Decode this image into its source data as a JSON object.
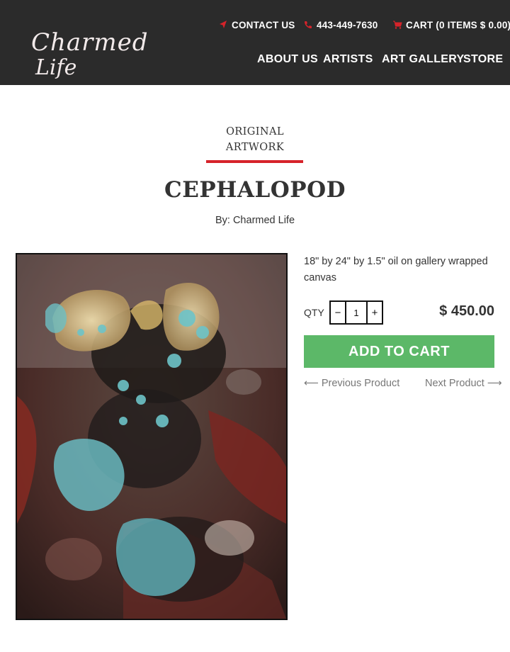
{
  "header": {
    "logo": {
      "line1": "Charmed",
      "line2": "Life"
    },
    "utility": {
      "contact_label": "CONTACT US",
      "phone": "443-449-7630",
      "cart_label": "CART (0 ITEMS $ 0.00)"
    },
    "nav": {
      "about": "ABOUT US",
      "artists": "ARTISTS",
      "gallery": "ART GALLERY",
      "store": "STORE"
    }
  },
  "product": {
    "collection_line1": "ORIGINAL",
    "collection_line2": "ARTWORK",
    "title": "CEPHALOPOD",
    "byline": "By: Charmed Life",
    "description": "18\" by 24\" by 1.5\" oil on gallery wrapped canvas",
    "qty_label": "QTY",
    "qty_value": "1",
    "qty_minus": "−",
    "qty_plus": "+",
    "price": "$ 450.00",
    "add_to_cart": "ADD TO CART",
    "prev": "⟵ Previous Product",
    "next": "Next Product ⟶"
  },
  "icons": {
    "contact": "location-arrow-icon",
    "phone": "phone-icon",
    "cart": "cart-icon"
  },
  "colors": {
    "header_bg": "#2b2b2b",
    "accent_red": "#d6232a",
    "button_green": "#5cb868",
    "link_gray": "#777777"
  }
}
